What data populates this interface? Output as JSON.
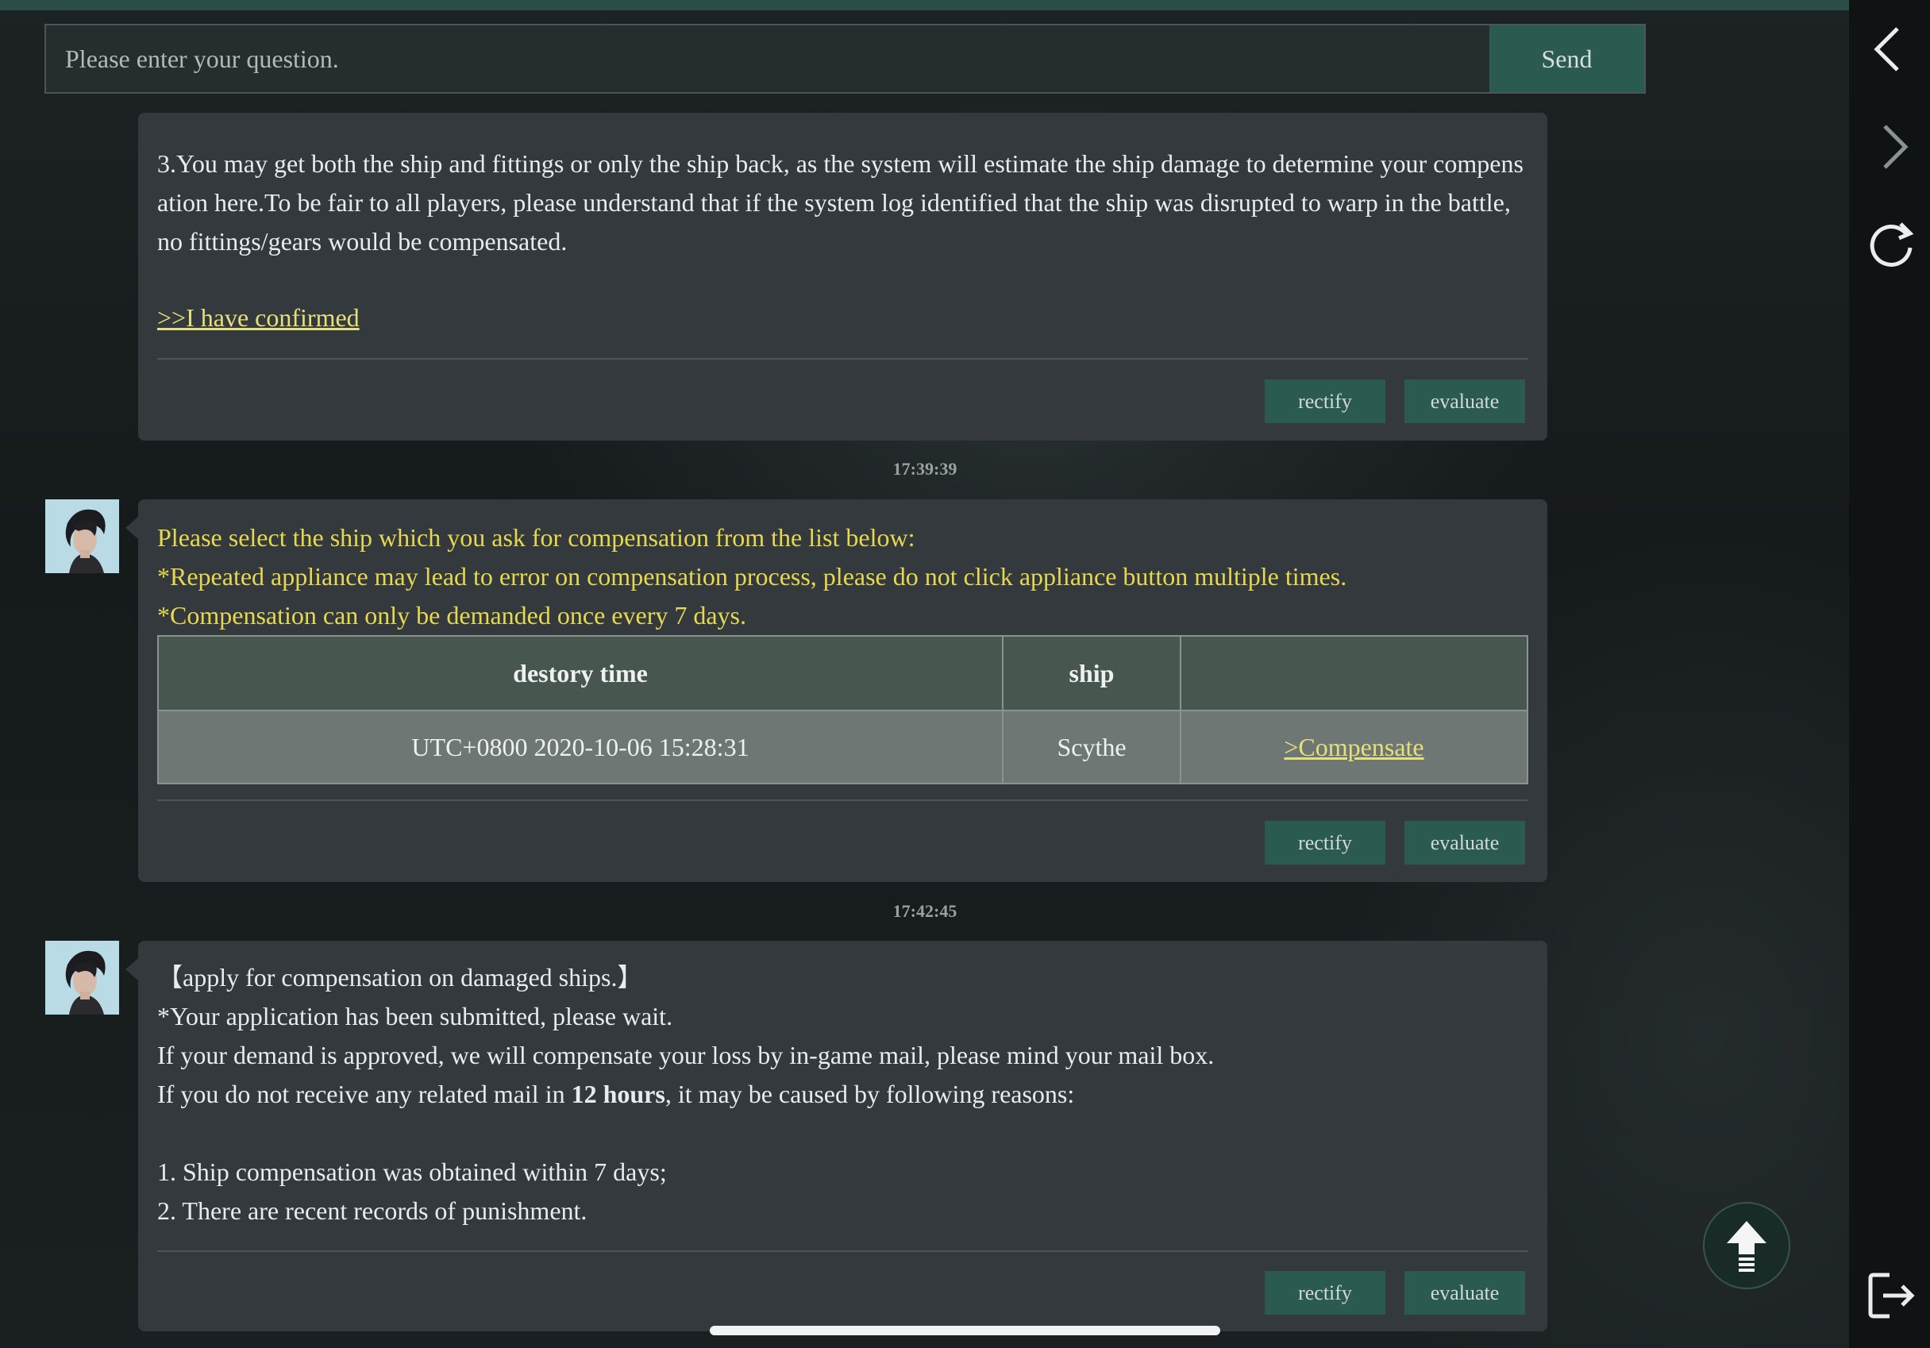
{
  "input": {
    "placeholder": "Please enter your question.",
    "send_label": "Send"
  },
  "messages": [
    {
      "text": "3.You may get both the ship and fittings or only the ship back, as the system will estimate the ship damage to determine your compensation here.To be fair to all players, please understand that if the system log identified that the ship was disrupted to warp in the battle, no fittings/gears would be compensated.",
      "link": ">>I have confirmed",
      "rectify": "rectify",
      "evaluate": "evaluate"
    },
    {
      "timestamp": "17:39:39",
      "lines": [
        "Please select the ship which you ask for compensation from the list below:",
        "*Repeated appliance may lead to error on compensation process, please do not click appliance button multiple times.",
        "*Compensation can only be demanded once every 7 days."
      ],
      "table": {
        "headers": [
          "destory time",
          "ship",
          ""
        ],
        "rows": [
          {
            "time": "UTC+0800 2020-10-06 15:28:31",
            "ship": "Scythe",
            "action": ">Compensate"
          }
        ]
      },
      "rectify": "rectify",
      "evaluate": "evaluate"
    },
    {
      "timestamp": "17:42:45",
      "title": "【apply for compensation on damaged ships.】",
      "line1": "*Your application has been submitted, please wait.",
      "line2": "If your demand is approved, we will compensate your loss by in-game mail, please mind your mail box.",
      "line3_pre": "If you do not receive any related mail in ",
      "line3_bold": "12 hours",
      "line3_post": ", it may be caused by following reasons:",
      "reasons": [
        "1. Ship compensation was obtained within 7 days;",
        "2. There are recent records of punishment."
      ],
      "rectify": "rectify",
      "evaluate": "evaluate"
    }
  ],
  "side_icons": [
    "back-arrow-icon",
    "forward-arrow-icon",
    "refresh-icon",
    "exit-icon"
  ],
  "colors": {
    "accent": "#2b5a50",
    "bubble": "#33393c",
    "highlight_text": "#e6d84f"
  }
}
